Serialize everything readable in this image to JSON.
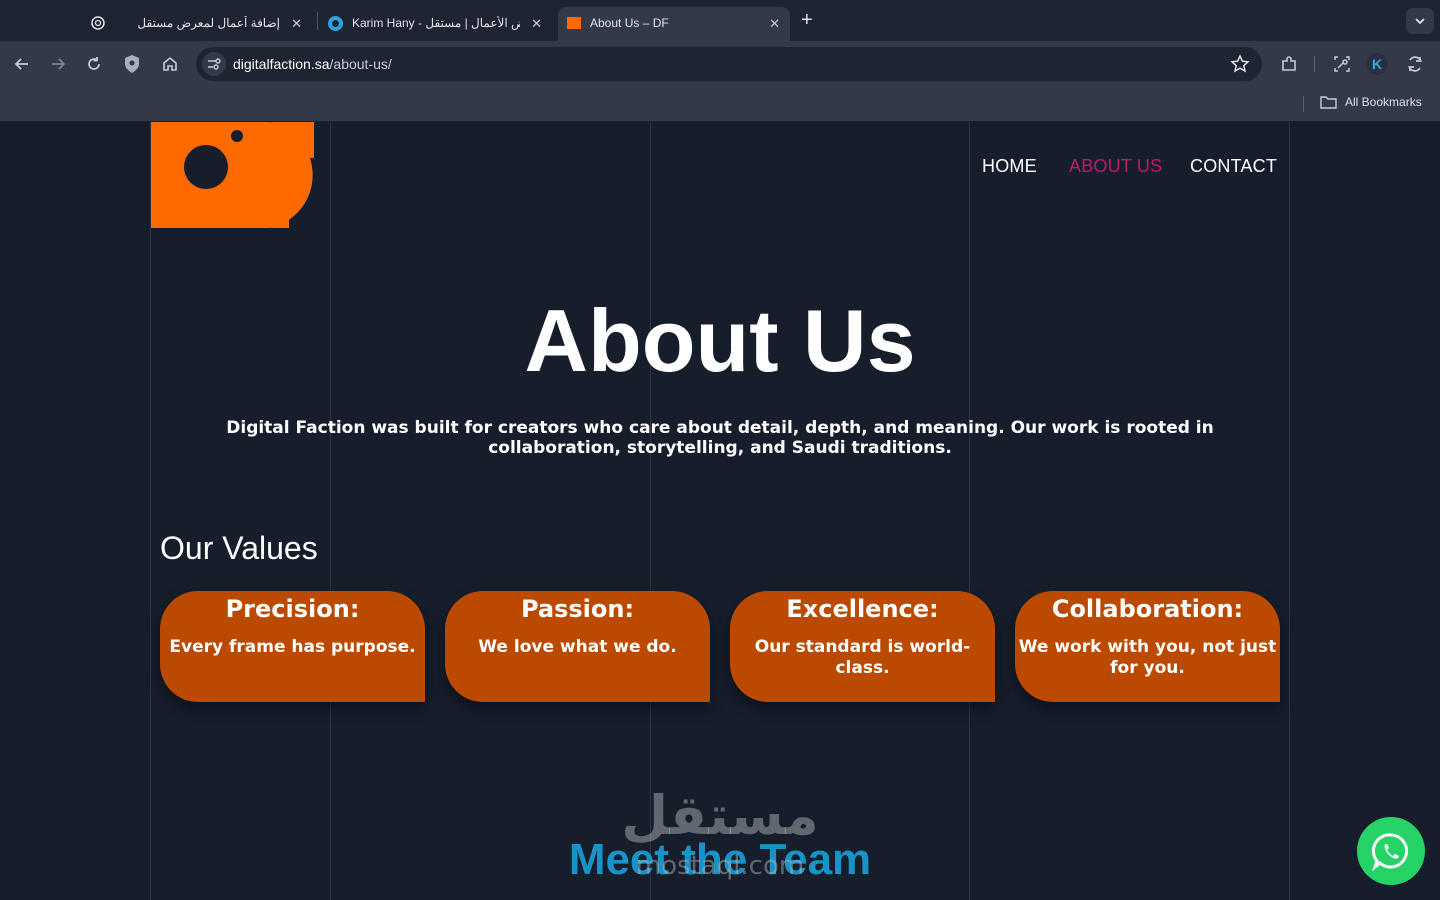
{
  "browser": {
    "tabs": [
      {
        "title": "إضافة أعمال لمعرض مستقل",
        "icon": "chatgpt-icon",
        "active": false
      },
      {
        "title": "Karim Hany - معرض الأعمال | مستقل",
        "icon": "mostaql-icon",
        "active": false
      },
      {
        "title": "About Us – DF",
        "icon": "df-logo-icon",
        "active": true
      }
    ],
    "address": {
      "host": "digitalfaction.sa",
      "path": "/about-us/"
    },
    "bookmarks_label": "All Bookmarks",
    "profile_initial": "K"
  },
  "nav": {
    "home": "HOME",
    "about": "ABOUT US",
    "contact": "CONTACT",
    "active_color": "#c2186a"
  },
  "hero": {
    "title": "About Us",
    "intro": "Digital Faction was built for creators who care about detail, depth, and meaning. Our work is rooted in collaboration, storytelling, and Saudi traditions."
  },
  "values": {
    "title": "Our Values",
    "items": [
      {
        "title": "Precision:",
        "text": "Every frame has purpose."
      },
      {
        "title": "Passion:",
        "text": "We love what we do."
      },
      {
        "title": "Excellence:",
        "text": "Our standard is world-class."
      },
      {
        "title": "Collaboration:",
        "text": "We work with you, not just for you."
      }
    ],
    "card_color": "#bb4a00"
  },
  "team": {
    "title": "Meet the Team"
  },
  "watermark": {
    "arabic": "مستقل",
    "latin": "mostaql.com"
  },
  "colors": {
    "brand_orange": "#ff6a00",
    "background": "#161e2c",
    "team_blue": "#1693c7",
    "whatsapp_green": "#25d366"
  }
}
